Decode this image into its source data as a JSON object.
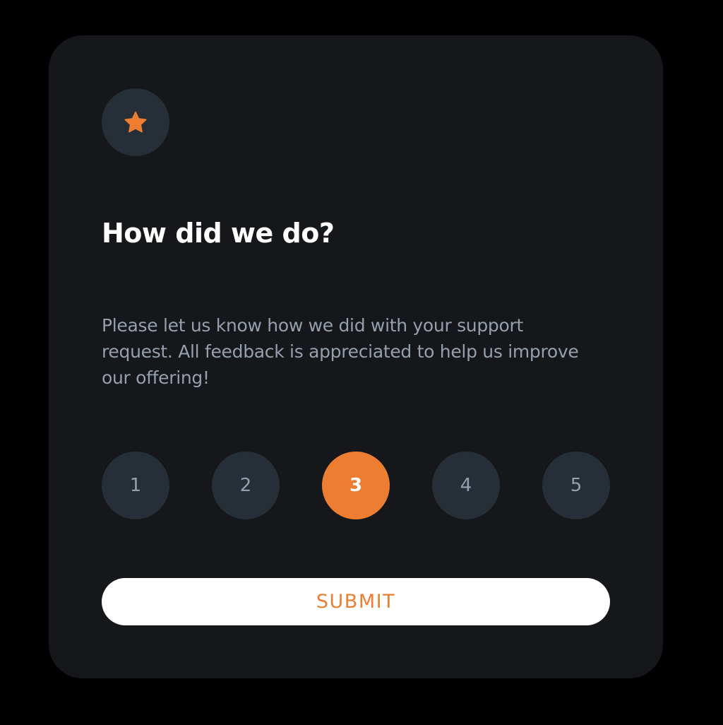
{
  "card": {
    "icon": "star-icon",
    "title": "How did we do?",
    "description": "Please let us know how we did with your support request. All feedback is appreciated to help us improve our offering!"
  },
  "rating": {
    "options": [
      "1",
      "2",
      "3",
      "4",
      "5"
    ],
    "selected": "3"
  },
  "submit": {
    "label": "SUBMIT"
  },
  "colors": {
    "page_background": "#000000",
    "card_background": "#15171b",
    "circle_background": "#262e38",
    "accent": "#ec7d31",
    "muted_text": "#969fad",
    "title_text": "#ffffff",
    "button_background": "#ffffff"
  }
}
